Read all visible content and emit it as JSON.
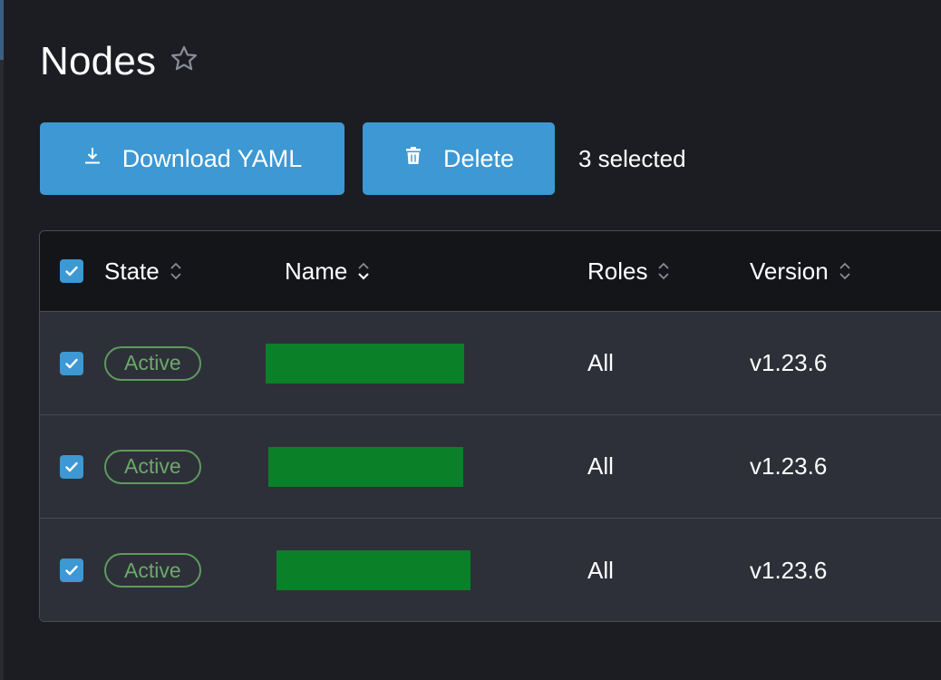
{
  "page": {
    "title": "Nodes"
  },
  "toolbar": {
    "download_label": "Download YAML",
    "delete_label": "Delete",
    "selected_text": "3 selected"
  },
  "table": {
    "columns": [
      {
        "label": "State"
      },
      {
        "label": "Name"
      },
      {
        "label": "Roles"
      },
      {
        "label": "Version"
      }
    ],
    "rows": [
      {
        "state": "Active",
        "name": "",
        "roles": "All",
        "version": "v1.23.6",
        "checked": true
      },
      {
        "state": "Active",
        "name": "",
        "roles": "All",
        "version": "v1.23.6",
        "checked": true
      },
      {
        "state": "Active",
        "name": "",
        "roles": "All",
        "version": "v1.23.6",
        "checked": true
      }
    ]
  },
  "colors": {
    "background": "#1c1d22",
    "primary": "#3d98d3",
    "header_bg": "#141519",
    "row_bg": "#2e3039",
    "active_badge": "#5d9a5d",
    "redaction": "#0a8028"
  },
  "icons": {
    "favorite": "star-icon",
    "download": "download-icon",
    "delete": "trash-icon",
    "sort": "sort-icon",
    "check": "checkmark-icon"
  }
}
